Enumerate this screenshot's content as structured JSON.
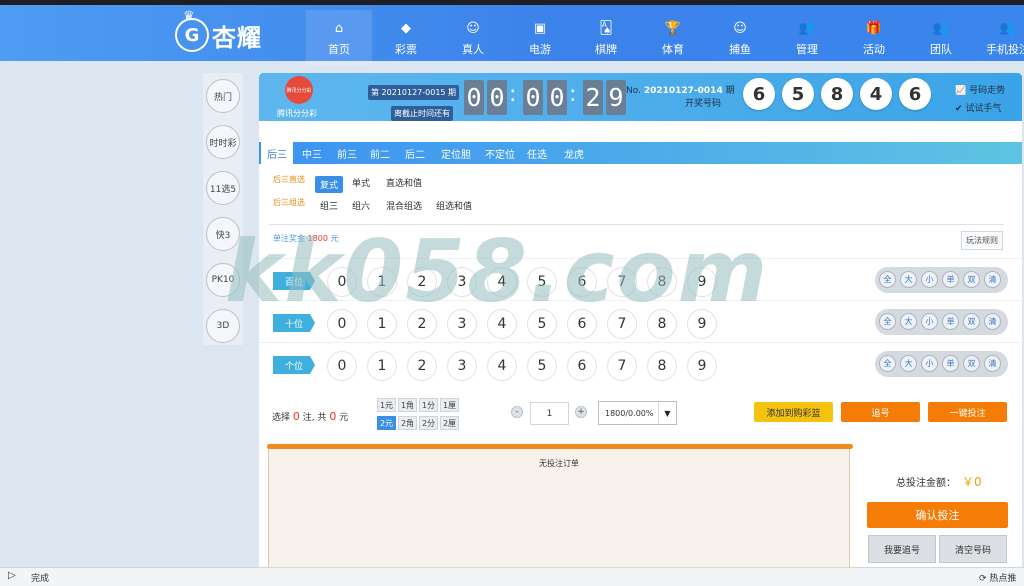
{
  "logo": {
    "mark": "G",
    "crown": "♛",
    "name": "杏耀"
  },
  "nav": [
    {
      "label": "首页",
      "icon": "home-icon",
      "glyph": "⌂"
    },
    {
      "label": "彩票",
      "icon": "ticket-icon",
      "glyph": "◆"
    },
    {
      "label": "真人",
      "icon": "person-icon",
      "glyph": "☺"
    },
    {
      "label": "电游",
      "icon": "slot-icon",
      "glyph": "▣"
    },
    {
      "label": "棋牌",
      "icon": "cards-icon",
      "glyph": "🂡"
    },
    {
      "label": "体育",
      "icon": "trophy-icon",
      "glyph": "🏆"
    },
    {
      "label": "捕鱼",
      "icon": "fish-icon",
      "glyph": "☺"
    },
    {
      "label": "管理",
      "icon": "people-icon",
      "glyph": "👥"
    },
    {
      "label": "活动",
      "icon": "gift-icon",
      "glyph": "🎁"
    },
    {
      "label": "团队",
      "icon": "team-icon",
      "glyph": "👥"
    },
    {
      "label": "手机投注",
      "icon": "mobile-icon",
      "glyph": "👥"
    }
  ],
  "sidebar": [
    "热门",
    "时时彩",
    "11选5",
    "快3",
    "PK10",
    "3D"
  ],
  "lottery": {
    "logo_text": "腾讯分分彩",
    "name": "腾讯分分彩",
    "current_period": "第 20210127-0015 期",
    "deadline_label": "离截止时间还有",
    "countdown": [
      "0",
      "0",
      "0",
      "0",
      "2",
      "9"
    ],
    "colon": ":",
    "last_period_prefix": "No.",
    "last_period": "20210127-0014",
    "last_period_suffix": "期",
    "draw_label": "开奖号码",
    "balls": [
      "6",
      "5",
      "8",
      "4",
      "6"
    ],
    "trend": "号码走势",
    "trial": "试试手气"
  },
  "play_tabs": [
    "后三",
    "中三",
    "前三",
    "前二",
    "后二",
    "定位胆",
    "不定位",
    "任选",
    "龙虎"
  ],
  "groups": [
    {
      "label": "后三直选",
      "options": [
        "复式",
        "单式",
        "直选和值"
      ]
    },
    {
      "label": "后三组选",
      "options": [
        "组三",
        "组六",
        "混合组选",
        "组选和值"
      ]
    }
  ],
  "prize": {
    "label": "单注奖金",
    "amount": "1800",
    "unit": "元"
  },
  "rules_button": "玩法规则",
  "positions": [
    "百位",
    "十位",
    "个位"
  ],
  "digits": [
    "0",
    "1",
    "2",
    "3",
    "4",
    "5",
    "6",
    "7",
    "8",
    "9"
  ],
  "quick": [
    "全",
    "大",
    "小",
    "单",
    "双",
    "清"
  ],
  "selection": {
    "prefix": "选择",
    "count": "0",
    "mid": "注, 共",
    "amount": "0",
    "suffix": "元"
  },
  "units_row1": [
    "1元",
    "1角",
    "1分",
    "1厘"
  ],
  "units_row2": [
    "2元",
    "2角",
    "2分",
    "2厘"
  ],
  "stepper": {
    "minus": "-",
    "plus": "+",
    "value": "1"
  },
  "odds": {
    "value": "1800/0.00%",
    "arrow": "▼"
  },
  "buttons": {
    "add_cart": "添加到购彩篮",
    "chase": "追号",
    "one_click": "一键投注",
    "confirm": "确认投注",
    "chase_number": "我要追号",
    "clear": "清空号码"
  },
  "orders": {
    "empty": "无投注订单",
    "total_label": "总投注金额：",
    "total_value": "￥0"
  },
  "watermark": "kk058.com",
  "status": {
    "done": "完成",
    "hot": "热点推"
  },
  "colors": {
    "accent": "#3a8ee6",
    "orange": "#f57c06",
    "header": "#3b82ea"
  }
}
